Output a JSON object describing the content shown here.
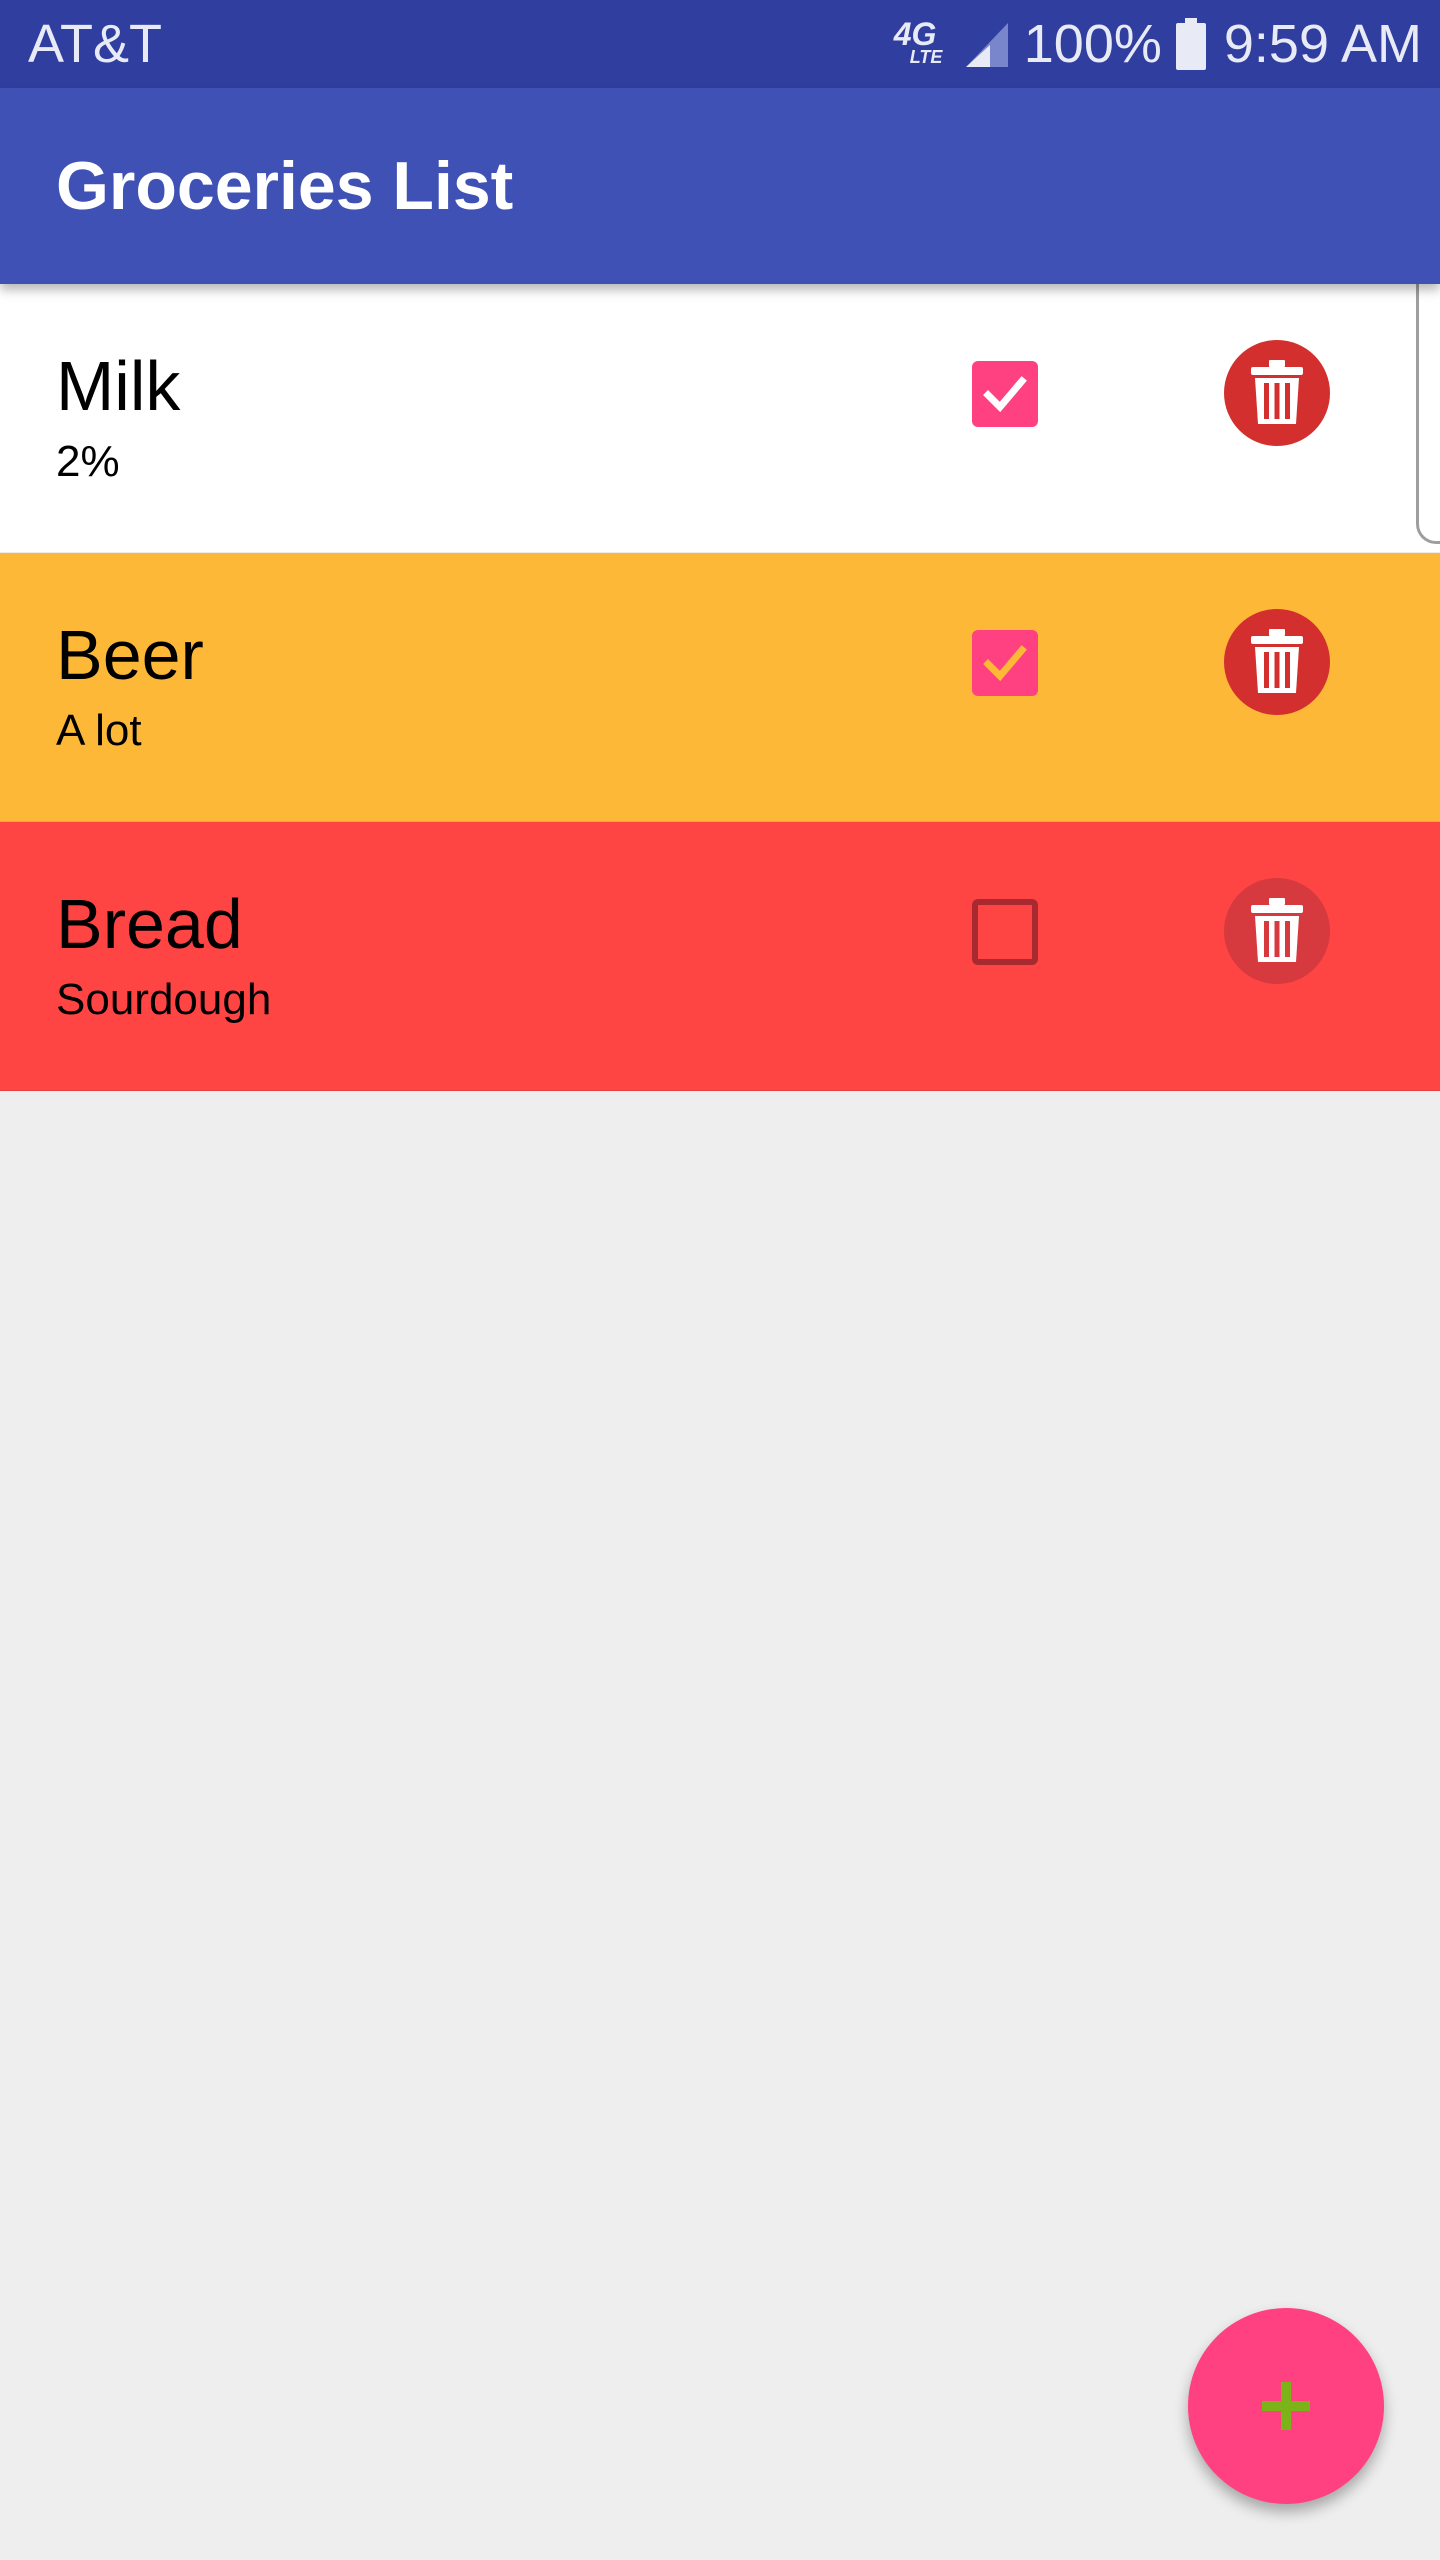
{
  "status_bar": {
    "carrier": "AT&T",
    "network_type": "4G",
    "network_subtype": "LTE",
    "battery_percent": "100%",
    "time": "9:59 AM",
    "icons": [
      "4g-lte-icon",
      "signal-icon",
      "battery-icon"
    ]
  },
  "app_bar": {
    "title": "Groceries List"
  },
  "items": [
    {
      "name": "Milk",
      "description": "2%",
      "checked": true,
      "background": "#ffffff",
      "checkmark_color": "#ffffff",
      "delete_button_color": "#d32f2f"
    },
    {
      "name": "Beer",
      "description": "A lot",
      "checked": true,
      "background": "#fdb837",
      "checkmark_color": "#fdb837",
      "delete_button_color": "#d32f2f"
    },
    {
      "name": "Bread",
      "description": "Sourdough",
      "checked": false,
      "background": "#ff4444",
      "checkmark_color": "#a82a30",
      "delete_button_color": "#d63a3e"
    }
  ],
  "fab": {
    "icon": "plus-icon",
    "color": "#ff4081",
    "icon_color": "#7cb318"
  },
  "colors": {
    "status_bar": "#303f9f",
    "app_bar": "#3f51b5",
    "background": "#eeeeee",
    "accent": "#ff4081"
  }
}
